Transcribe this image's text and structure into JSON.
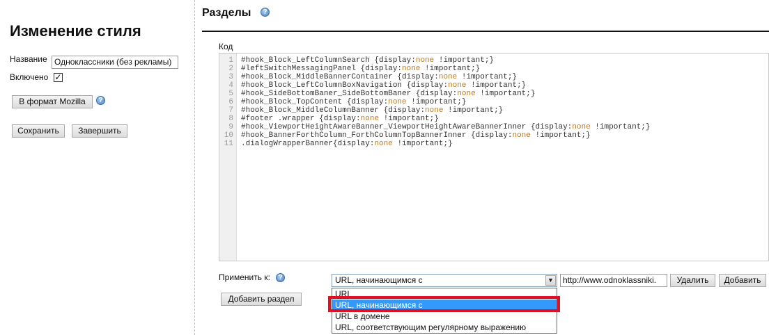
{
  "left_panel": {
    "title": "Изменение стиля",
    "name_label": "Название",
    "name_value": "Одноклассники (без рекламы)",
    "enabled_label": "Включено",
    "enabled_checked": "✓",
    "mozilla_button": "В формат Mozilla",
    "help_glyph": "?",
    "save_button": "Сохранить",
    "finish_button": "Завершить"
  },
  "right_panel": {
    "title": "Разделы",
    "code_label": "Код",
    "line_numbers": [
      "1",
      "2",
      "3",
      "4",
      "5",
      "6",
      "7",
      "8",
      "9",
      "10",
      "11"
    ],
    "code_lines": [
      {
        "sel": "#hook_Block_LeftColumnSearch {display:",
        "kw": "none",
        "rest": " !important;}"
      },
      {
        "sel": "#leftSwitchMessagingPanel {display:",
        "kw": "none",
        "rest": " !important;}"
      },
      {
        "sel": "#hook_Block_MiddleBannerContainer {display:",
        "kw": "none",
        "rest": " !important;}"
      },
      {
        "sel": "#hook_Block_LeftColumnBoxNavigation {display:",
        "kw": "none",
        "rest": " !important;}"
      },
      {
        "sel": "#hook_SideBottomBaner_SideBottomBaner {display:",
        "kw": "none",
        "rest": " !important;}"
      },
      {
        "sel": "#hook_Block_TopContent {display:",
        "kw": "none",
        "rest": " !important;}"
      },
      {
        "sel": "#hook_Block_MiddleColumnBanner {display:",
        "kw": "none",
        "rest": " !important;}"
      },
      {
        "sel": "#footer .wrapper {display:",
        "kw": "none",
        "rest": " !important;}"
      },
      {
        "sel": "#hook_ViewportHeightAwareBanner_ViewportHeightAwareBannerInner {display:",
        "kw": "none",
        "rest": " !important;}"
      },
      {
        "sel": "#hook_BannerForthColumn_ForthColumnTopBannerInner {display:",
        "kw": "none",
        "rest": " !important;}"
      },
      {
        "sel": ".dialogWrapperBanner{display:",
        "kw": "none",
        "rest": " !important;}"
      }
    ],
    "apply_label": "Применить к:",
    "apply_select_value": "URL, начинающимся с",
    "dropdown_options": [
      "URL",
      "URL, начинающимся с",
      "URL в домене",
      "URL, соответствующим регулярному выражению"
    ],
    "selected_option_index": 1,
    "url_value": "http://www.odnoklassniki.",
    "delete_button": "Удалить",
    "add_button": "Добавить",
    "add_section_button": "Добавить раздел",
    "select_arrow_glyph": "▼"
  },
  "colors": {
    "keyword": "#c07a20",
    "selection": "#3399ff",
    "highlight_border": "#dd1122"
  }
}
